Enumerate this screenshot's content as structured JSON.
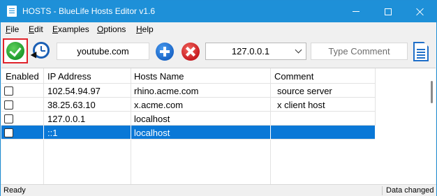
{
  "window": {
    "title": "HOSTS - BlueLife Hosts Editor v1.6",
    "title_bar_color": "#1e90d8"
  },
  "menu": {
    "items": [
      {
        "label": "File",
        "underline": "F",
        "rest": "ile"
      },
      {
        "label": "Edit",
        "underline": "E",
        "rest": "dit"
      },
      {
        "label": "Examples",
        "underline": "E",
        "rest": "xamples"
      },
      {
        "label": "Options",
        "underline": "O",
        "rest": "ptions"
      },
      {
        "label": "Help",
        "underline": "H",
        "rest": "elp"
      }
    ]
  },
  "toolbar": {
    "host_name_value": "youtube.com",
    "ip_value": "127.0.0.1",
    "comment_placeholder": "Type Comment",
    "icons": [
      "apply-check-icon",
      "history-clock-icon",
      "add-icon",
      "delete-icon",
      "dropdown-chevron-icon",
      "document-icon"
    ]
  },
  "table": {
    "columns": [
      "Enabled",
      "IP Address",
      "Hosts Name",
      "Comment"
    ],
    "rows": [
      {
        "enabled": false,
        "ip": "102.54.94.97",
        "host": "rhino.acme.com",
        "comment": "source server",
        "selected": false
      },
      {
        "enabled": false,
        "ip": "38.25.63.10",
        "host": "x.acme.com",
        "comment": "x client host",
        "selected": false
      },
      {
        "enabled": false,
        "ip": "127.0.0.1",
        "host": "localhost",
        "comment": "",
        "selected": false
      },
      {
        "enabled": false,
        "ip": "::1",
        "host": "localhost",
        "comment": "",
        "selected": true
      }
    ],
    "selection_color": "#0a78d7"
  },
  "status": {
    "left": "Ready",
    "right": "Data changed"
  }
}
